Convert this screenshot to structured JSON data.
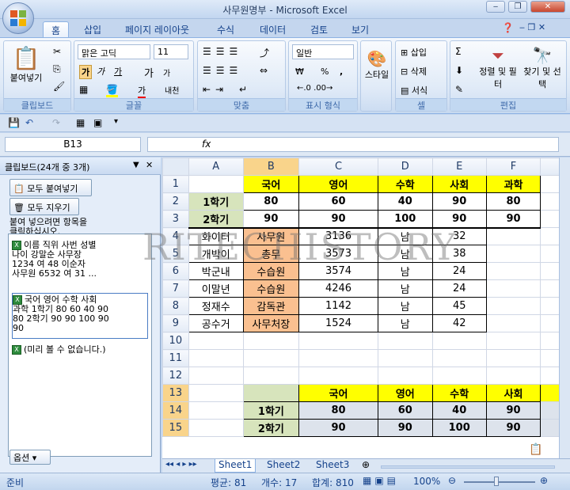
{
  "window": {
    "title": "사무원명부 - Microsoft Excel",
    "controls": [
      "‒",
      "❐",
      "✕"
    ]
  },
  "ribbon_tabs": [
    "홈",
    "삽입",
    "페이지 레이아웃",
    "수식",
    "데이터",
    "검토",
    "보기"
  ],
  "ribbon": {
    "clipboard": {
      "paste": "붙여넣기",
      "label": "클립보드"
    },
    "font": {
      "name": "맑은 고딕",
      "size": "11",
      "bold": "가",
      "italic": "가",
      "underline": "가",
      "grow": "가",
      "shrink": "가",
      "color": "가",
      "phonetic": "내천",
      "label": "글꼴"
    },
    "align": {
      "label": "맞춤"
    },
    "number": {
      "format": "일반",
      "label": "표시 형식",
      "currency": "₩",
      "percent": "%",
      "comma": ","
    },
    "styles": {
      "label": "스타일"
    },
    "cells": {
      "insert": "삽입",
      "delete": "삭제",
      "format": "서식",
      "label": "셀"
    },
    "editing": {
      "sort": "정렬 및 필터",
      "find": "찾기 및 선택",
      "label": "편집"
    }
  },
  "name_box": "B13",
  "formula_symbol": "fx",
  "clipboard_pane": {
    "title": "클립보드(24개 중 3개)",
    "paste_all": "모두 붙여넣기",
    "clear_all": "모두 지우기",
    "hint": "붙여 넣으려면 항목을\n클릭하십시오.",
    "items": [
      "이름 직위 사번 성별\n나이 강말순 사무장\n1234 여 48 이순자\n사무원 6532 여 31 ...",
      "국어 영어 수학 사회\n과학 1학기 80 60 40 90\n80 2학기 90 90 100 90\n90",
      "(미리 볼 수 없습니다.)"
    ],
    "options": "옵션 ▾"
  },
  "columns": [
    "A",
    "B",
    "C",
    "D",
    "E",
    "F"
  ],
  "rows": [
    [
      "",
      "국어",
      "영어",
      "수학",
      "사회",
      "과학"
    ],
    [
      "1학기",
      "80",
      "60",
      "40",
      "90",
      "80"
    ],
    [
      "2학기",
      "90",
      "90",
      "100",
      "90",
      "90"
    ],
    [
      "화이터",
      "사무원",
      "3136",
      "남",
      "32",
      ""
    ],
    [
      "개박이",
      "총무",
      "3573",
      "남",
      "38",
      ""
    ],
    [
      "박군내",
      "수습원",
      "3574",
      "남",
      "24",
      ""
    ],
    [
      "이말년",
      "수습원",
      "4246",
      "남",
      "24",
      ""
    ],
    [
      "정재수",
      "감독관",
      "1142",
      "남",
      "45",
      ""
    ],
    [
      "공수거",
      "사무처장",
      "1524",
      "남",
      "42",
      ""
    ],
    [
      "",
      "",
      "",
      "",
      "",
      ""
    ],
    [
      "",
      "",
      "",
      "",
      "",
      ""
    ],
    [
      "",
      "",
      "",
      "",
      "",
      ""
    ],
    [
      "",
      "",
      "국어",
      "영어",
      "수학",
      "사회"
    ],
    [
      "",
      "1학기",
      "80",
      "60",
      "40",
      "90"
    ],
    [
      "",
      "2학기",
      "90",
      "90",
      "100",
      "90"
    ]
  ],
  "watermark": "RITECHISTORY",
  "sheets": [
    "Sheet1",
    "Sheet2",
    "Sheet3"
  ],
  "status": {
    "mode": "준비",
    "average": "평균: 81",
    "count": "개수: 17",
    "sum": "합계: 810",
    "zoom": "100%"
  },
  "colors": {
    "header_yellow": "#ffff00",
    "label_green": "#d7e4bc",
    "orange": "#fac090",
    "selected_header": "#f9d48b"
  }
}
